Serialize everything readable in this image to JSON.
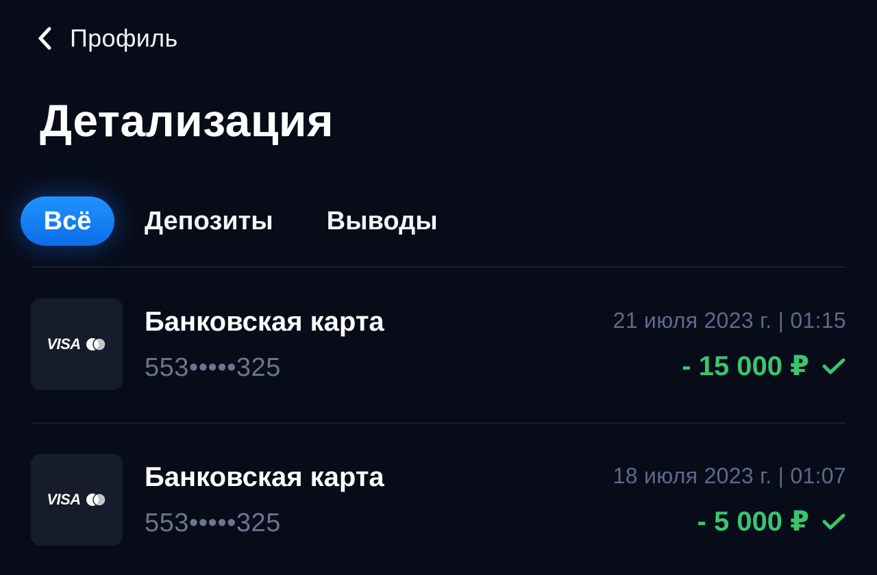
{
  "header": {
    "back_label": "Профиль",
    "title": "Детализация"
  },
  "tabs": [
    {
      "label": "Всё",
      "active": true
    },
    {
      "label": "Депозиты",
      "active": false
    },
    {
      "label": "Выводы",
      "active": false
    }
  ],
  "transactions": [
    {
      "method": "Банковская карта",
      "card_logo": "VISA",
      "card_number": "553•••••325",
      "date": "21 июля 2023 г. | 01:15",
      "amount": "- 15 000 ₽",
      "status_icon": "check-icon"
    },
    {
      "method": "Банковская карта",
      "card_logo": "VISA",
      "card_number": "553•••••325",
      "date": "18 июля 2023 г. | 01:07",
      "amount": "- 5 000 ₽",
      "status_icon": "check-icon"
    }
  ],
  "colors": {
    "background": "#080c19",
    "accent": "#1a80f5",
    "success": "#3bc46f",
    "muted_text": "#6b7590",
    "tile": "#171c2c"
  }
}
